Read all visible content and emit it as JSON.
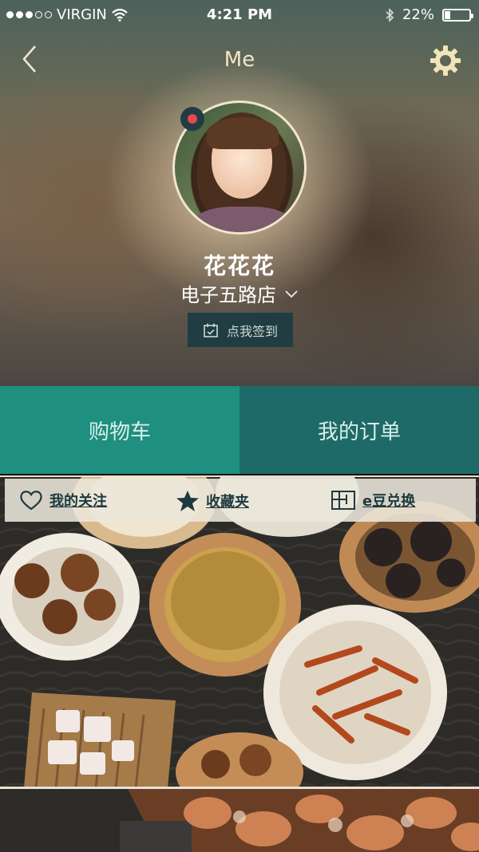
{
  "status_bar": {
    "carrier": "VIRGIN",
    "time": "4:21 PM",
    "battery_percent_text": "22%",
    "battery_level": 0.22
  },
  "nav": {
    "title": "Me"
  },
  "profile": {
    "name": "花花花",
    "store": "电子五路店",
    "checkin_label": "点我签到"
  },
  "tabs": [
    {
      "label": "购物车"
    },
    {
      "label": "我的订单"
    }
  ],
  "quick_links": [
    {
      "label": "我的关注",
      "icon": "heart-icon"
    },
    {
      "label": "收藏夹",
      "icon": "star-icon"
    },
    {
      "label": "e豆兑换",
      "icon": "exchange-icon"
    }
  ],
  "colors": {
    "accent_teal": "#1f8f80",
    "dark_teal": "#1e6a68",
    "badge_dark": "#233b42",
    "status_red": "#e54b4b",
    "title_cream": "#f4e4c6"
  }
}
